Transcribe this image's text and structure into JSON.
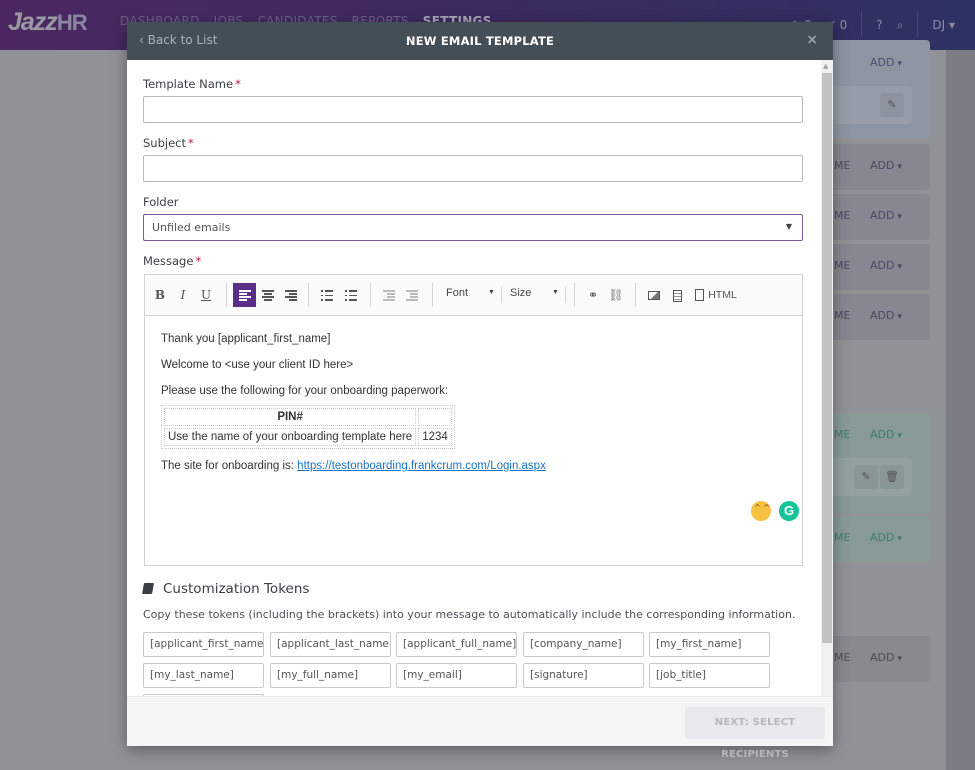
{
  "app": {
    "logo": {
      "left": "Jazz",
      "right": "HR"
    },
    "nav": [
      "DASHBOARD",
      "JOBS",
      "CANDIDATES",
      "REPORTS",
      "SETTINGS"
    ],
    "active_nav": "SETTINGS",
    "views_count": "0",
    "tasks_count": "0",
    "help_icon": "?",
    "search_icon": "⌕",
    "user_initials": "DJ",
    "background_cards": {
      "add_label": "ADD",
      "name_fragment": "ME"
    }
  },
  "modal": {
    "back_label": "Back to List",
    "title": "NEW EMAIL TEMPLATE",
    "close_label": "×",
    "fields": {
      "template_name": {
        "label": "Template Name",
        "required": "*",
        "value": "",
        "placeholder": ""
      },
      "subject": {
        "label": "Subject",
        "required": "*",
        "value": "",
        "placeholder": ""
      },
      "folder": {
        "label": "Folder",
        "selected": "Unfiled emails"
      },
      "message": {
        "label": "Message",
        "required": "*"
      }
    },
    "toolbar": {
      "bold": "B",
      "italic": "I",
      "underline": "U",
      "font_label": "Font",
      "size_label": "Size",
      "html_label": "HTML",
      "active_button": "align-left",
      "accent_color": "#5a2e87"
    },
    "message_body": {
      "line1": "Thank you [applicant_first_name]",
      "line2": "Welcome to <use your client ID here>",
      "line3": "Please use the following for your onboarding paperwork:",
      "table": {
        "header": [
          "PIN#",
          ""
        ],
        "rows": [
          [
            "Use the name of your onboarding template  here",
            "1234"
          ]
        ]
      },
      "site_prefix": "The site for onboarding is: ",
      "site_url": "https://testonboarding.frankcrum.com/Login.aspx"
    },
    "tokens": {
      "title": "Customization Tokens",
      "description": "Copy these tokens (including the brackets) into your message to automatically include the corresponding information.",
      "items": [
        "[applicant_first_name]",
        "[applicant_last_name]",
        "[applicant_full_name]",
        "[company_name]",
        "[my_first_name]",
        "[my_last_name]",
        "[my_full_name]",
        "[my_email]",
        "[signature]",
        "[job_title]"
      ]
    },
    "footer": {
      "next_label": "NEXT: SELECT RECIPIENTS"
    }
  }
}
